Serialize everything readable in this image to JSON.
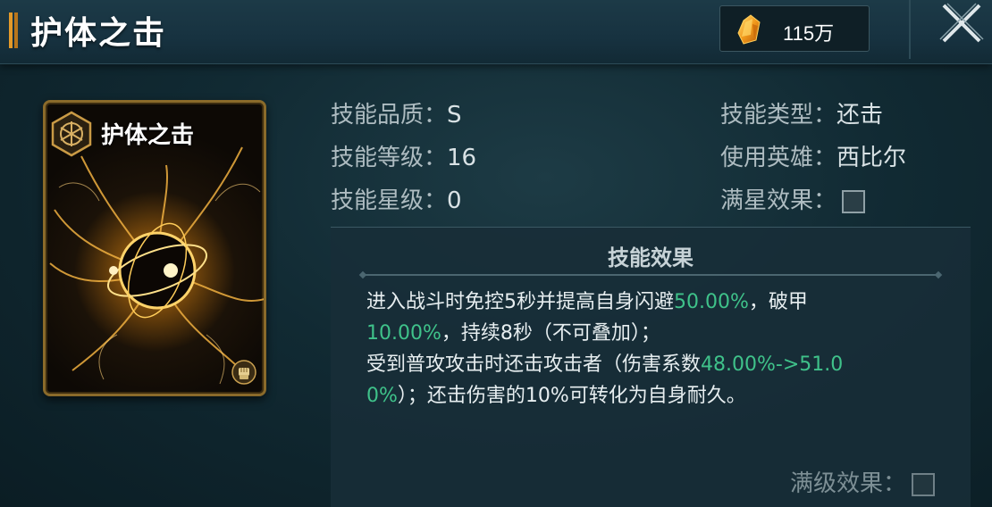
{
  "header": {
    "title": "护体之击",
    "currency": {
      "icon": "crystal-icon",
      "value": "115万"
    }
  },
  "card": {
    "title": "护体之击",
    "badge_icon": "hexagon-emblem-icon",
    "type_icon": "fist-icon"
  },
  "info": {
    "quality_label": "技能品质：",
    "quality_value": "S",
    "level_label": "技能等级：",
    "level_value": "16",
    "star_label": "技能星级：",
    "star_value": "0",
    "type_label": "技能类型：",
    "type_value": "还击",
    "hero_label": "使用英雄：",
    "hero_value": "西比尔",
    "full_star_label": "满星效果："
  },
  "effect": {
    "title": "技能效果",
    "seg1": "进入战斗时免控5秒并提高自身闪避",
    "seg2": "50.00%",
    "seg3": "，破甲",
    "seg4": "10.00%",
    "seg5": "，持续8秒（不可叠加）；",
    "seg6": "受到普攻攻击时还击攻击者（伤害系数",
    "seg7": "48.00%->51.00%",
    "seg8": "）；还击伤害的10%可转化为自身耐久。",
    "max_level_label": "满级效果："
  },
  "colors": {
    "highlight": "#3fc28a",
    "gold": "#e39a2a"
  }
}
